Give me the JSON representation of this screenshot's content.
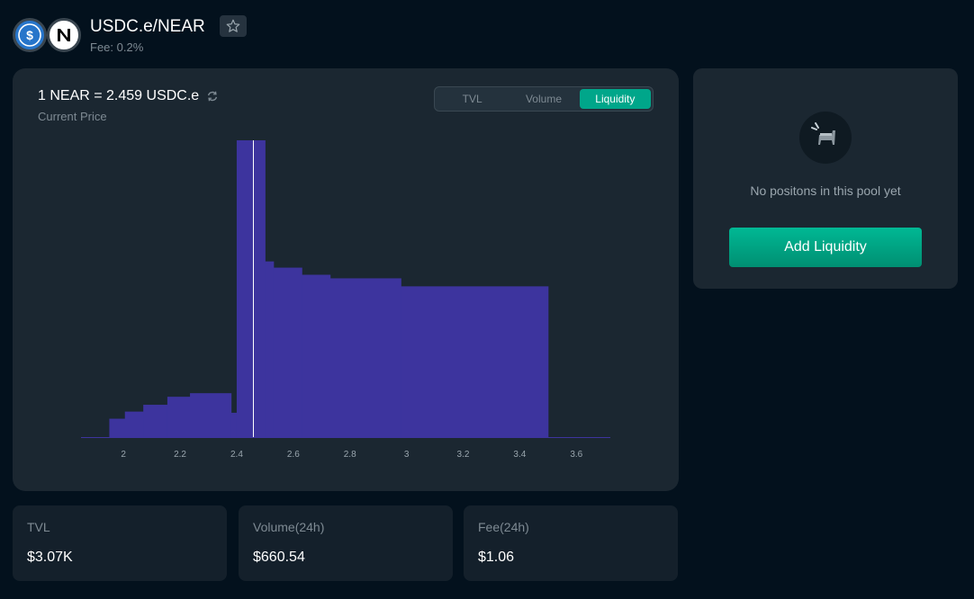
{
  "header": {
    "pair_title": "USDC.e/NEAR",
    "fee_text": "Fee: 0.2%",
    "token_icons": [
      "usdc-icon",
      "near-icon"
    ]
  },
  "chart_panel": {
    "price_text": "1 NEAR = 2.459 USDC.e",
    "price_label": "Current Price",
    "tabs": [
      {
        "label": "TVL",
        "active": false
      },
      {
        "label": "Volume",
        "active": false
      },
      {
        "label": "Liquidity",
        "active": true
      }
    ]
  },
  "position_panel": {
    "empty_text": "No positons in this pool yet",
    "add_button_label": "Add Liquidity"
  },
  "stats": {
    "tvl_label": "TVL",
    "tvl_value": "$3.07K",
    "volume_label": "Volume(24h)",
    "volume_value": "$660.54",
    "fee_label": "Fee(24h)",
    "fee_value": "$1.06"
  },
  "colors": {
    "accent": "#00a68a",
    "bar": "#3d349e",
    "background": "#03111d",
    "card": "#1b2731"
  },
  "chart_data": {
    "type": "bar",
    "title": "",
    "xlabel": "",
    "ylabel": "",
    "xticks": [
      "2",
      "2.2",
      "2.4",
      "2.6",
      "2.8",
      "3",
      "3.2",
      "3.4",
      "3.6"
    ],
    "xlim": [
      1.85,
      3.72
    ],
    "ylim": [
      0,
      100
    ],
    "current_price": 2.459,
    "bars": [
      {
        "x0": 1.95,
        "x1": 2.005,
        "value": 6.2
      },
      {
        "x0": 2.005,
        "x1": 2.07,
        "value": 8.6
      },
      {
        "x0": 2.07,
        "x1": 2.155,
        "value": 10.9
      },
      {
        "x0": 2.155,
        "x1": 2.235,
        "value": 13.6
      },
      {
        "x0": 2.235,
        "x1": 2.38,
        "value": 14.8
      },
      {
        "x0": 2.38,
        "x1": 2.4,
        "value": 8.2
      },
      {
        "x0": 2.4,
        "x1": 2.5,
        "value": 100
      },
      {
        "x0": 2.5,
        "x1": 2.53,
        "value": 59.2
      },
      {
        "x0": 2.53,
        "x1": 2.63,
        "value": 57.1
      },
      {
        "x0": 2.63,
        "x1": 2.73,
        "value": 54.7
      },
      {
        "x0": 2.73,
        "x1": 2.98,
        "value": 53.5
      },
      {
        "x0": 2.98,
        "x1": 3.5,
        "value": 50.8
      }
    ]
  }
}
